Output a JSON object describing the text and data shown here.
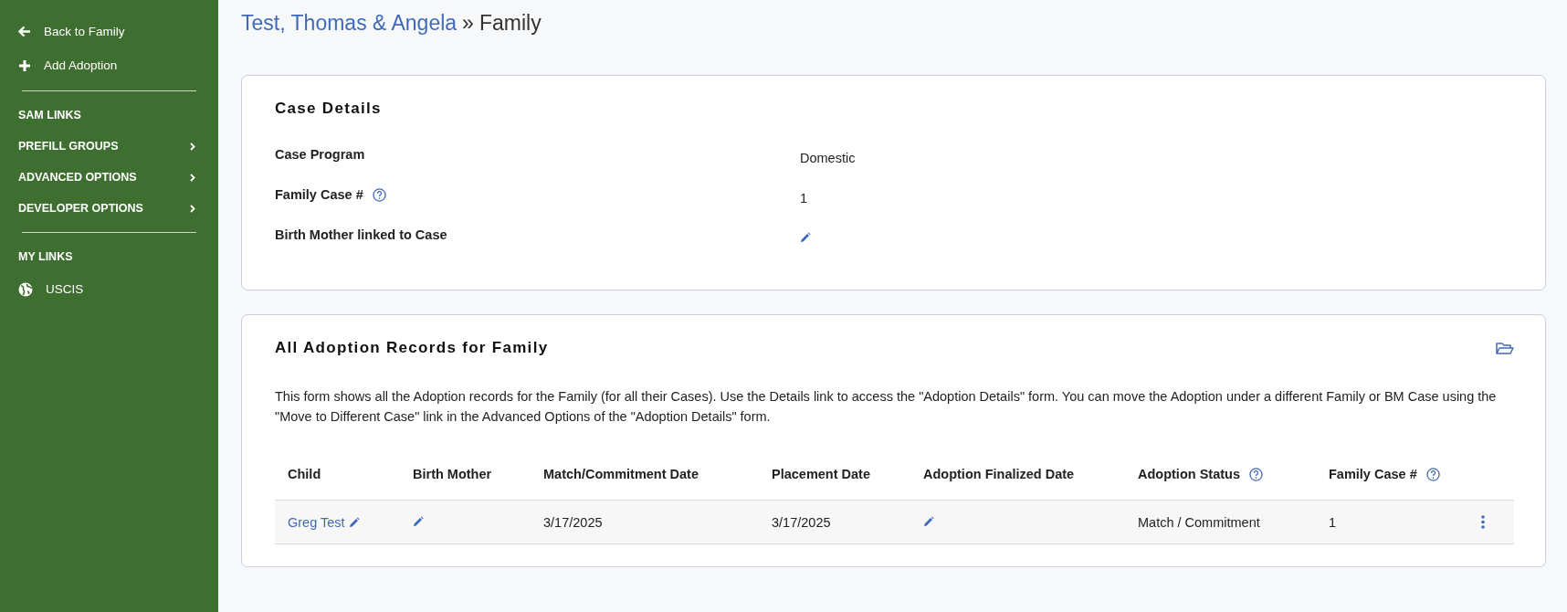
{
  "sidebar": {
    "actions": [
      {
        "label": "Back to Family"
      },
      {
        "label": "Add Adoption"
      }
    ],
    "sections": [
      {
        "label": "SAM LINKS",
        "has_submenu": false
      },
      {
        "label": "PREFILL GROUPS",
        "has_submenu": true
      },
      {
        "label": "ADVANCED OPTIONS",
        "has_submenu": true
      },
      {
        "label": "DEVELOPER OPTIONS",
        "has_submenu": true
      }
    ],
    "my_links": {
      "label": "MY LINKS",
      "items": [
        {
          "label": "USCIS"
        }
      ]
    }
  },
  "breadcrumb": {
    "link": "Test, Thomas & Angela",
    "separator": "»",
    "current": "Family"
  },
  "case_details": {
    "title": "Case Details",
    "fields": [
      {
        "label": "Case Program",
        "help": false,
        "kind": "text",
        "value": "Domestic"
      },
      {
        "label": "Family Case #",
        "help": true,
        "kind": "text",
        "value": "1"
      },
      {
        "label": "Birth Mother linked to Case",
        "help": false,
        "kind": "edit"
      }
    ]
  },
  "adoption_records": {
    "title": "All Adoption Records for Family",
    "description": "This form shows all the Adoption records for the Family (for all their Cases). Use the Details link to access the \"Adoption Details\" form. You can move the Adoption under a different Family or BM Case using the \"Move to Different Case\" link in the Advanced Options of the \"Adoption Details\" form.",
    "table": {
      "columns": [
        {
          "label": "Child",
          "help": false
        },
        {
          "label": "Birth Mother",
          "help": false
        },
        {
          "label": "Match/Commitment Date",
          "help": false
        },
        {
          "label": "Placement Date",
          "help": false
        },
        {
          "label": "Adoption Finalized Date",
          "help": false
        },
        {
          "label": "Adoption Status",
          "help": true
        },
        {
          "label": "Family Case #",
          "help": true
        }
      ],
      "rows": [
        {
          "cells": [
            {
              "kind": "link-edit",
              "text": "Greg Test"
            },
            {
              "kind": "edit"
            },
            {
              "kind": "text",
              "text": "3/17/2025"
            },
            {
              "kind": "text",
              "text": "3/17/2025"
            },
            {
              "kind": "edit"
            },
            {
              "kind": "text",
              "text": "Match / Commitment"
            },
            {
              "kind": "text",
              "text": "1"
            }
          ]
        }
      ]
    }
  }
}
